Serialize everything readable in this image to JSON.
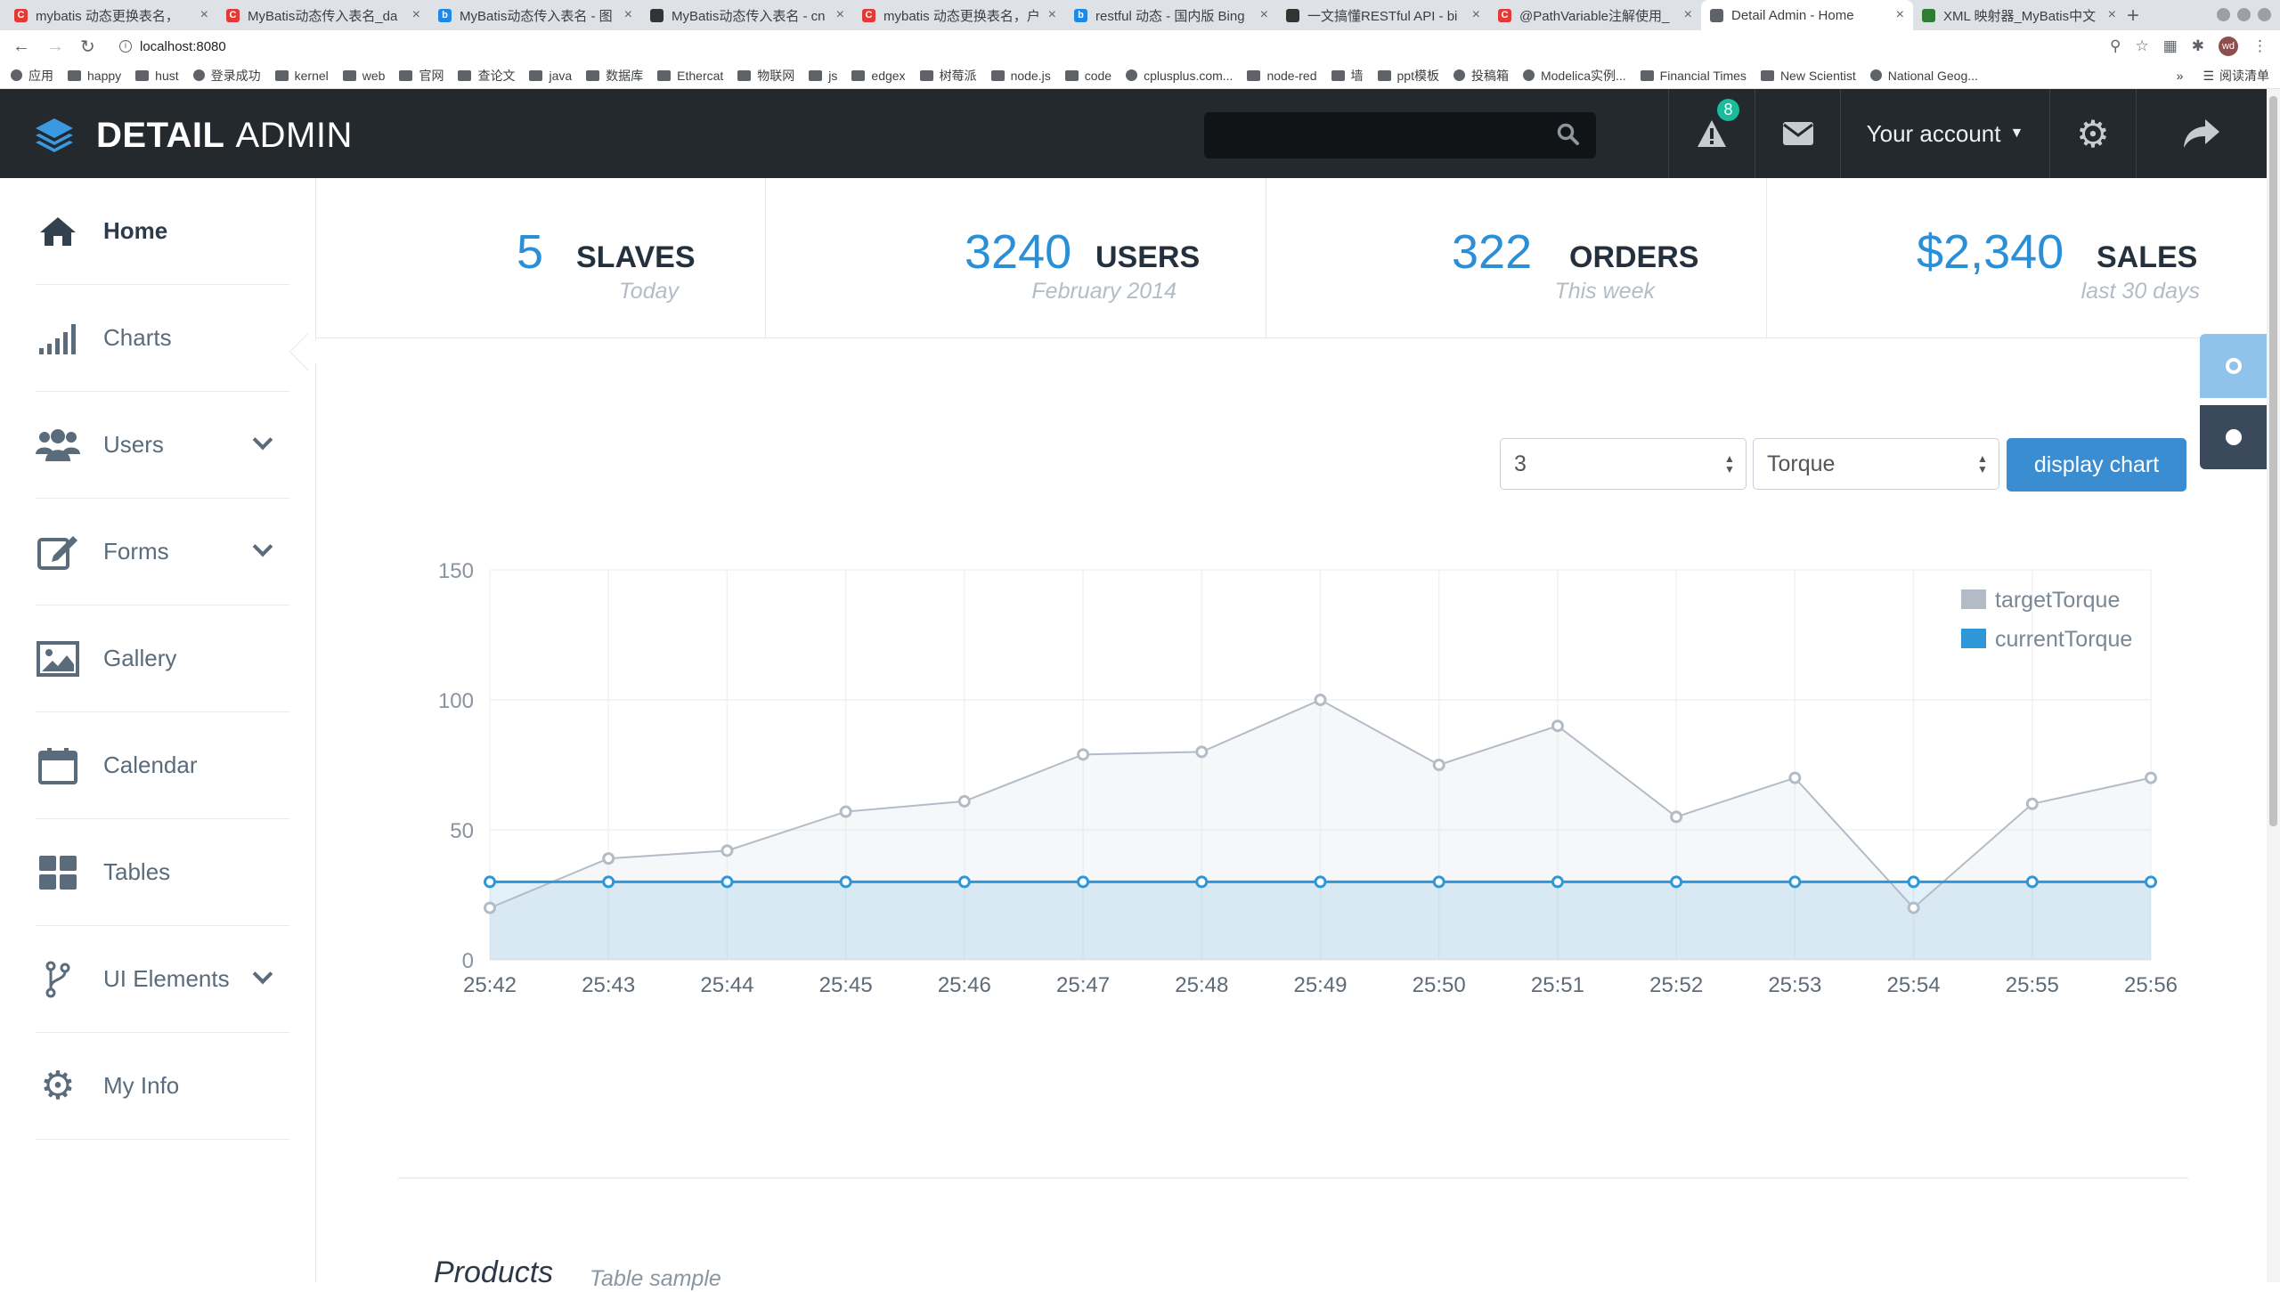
{
  "browser": {
    "tabs": [
      {
        "title": "mybatis 动态更换表名，",
        "favicon": "#e53935",
        "glyph": "C"
      },
      {
        "title": "MyBatis动态传入表名_da",
        "favicon": "#e53935",
        "glyph": "C"
      },
      {
        "title": "MyBatis动态传入表名 - 图",
        "favicon": "#1e88e5",
        "glyph": "b"
      },
      {
        "title": "MyBatis动态传入表名 - cn",
        "favicon": "#333333",
        "glyph": ""
      },
      {
        "title": "mybatis 动态更换表名，户",
        "favicon": "#e53935",
        "glyph": "C"
      },
      {
        "title": "restful 动态 - 国内版 Bing",
        "favicon": "#1e88e5",
        "glyph": "b"
      },
      {
        "title": "一文搞懂RESTful API - bi",
        "favicon": "#333333",
        "glyph": ""
      },
      {
        "title": "@PathVariable注解使用_",
        "favicon": "#e53935",
        "glyph": "C"
      },
      {
        "title": "Detail Admin - Home",
        "favicon": "#5f6368",
        "glyph": ""
      },
      {
        "title": "XML 映射器_MyBatis中文",
        "favicon": "#2e7d32",
        "glyph": ""
      }
    ],
    "url": "localhost:8080",
    "bookmarks": [
      "应用",
      "happy",
      "hust",
      "登录成功",
      "kernel",
      "web",
      "官网",
      "查论文",
      "java",
      "数据库",
      "Ethercat",
      "物联网",
      "js",
      "edgex",
      "树莓派",
      "node.js",
      "code",
      "cplusplus.com...",
      "node-red",
      "墙",
      "ppt模板",
      "投稿箱",
      "Modelica实例...",
      "Financial Times",
      "New Scientist",
      "National Geog..."
    ],
    "bookmarks_more": "»",
    "reading_list": "阅读清单",
    "profile_initials": "wd"
  },
  "app": {
    "logo_word1": "DETAIL",
    "logo_word2": "ADMIN",
    "alerts_count": "8",
    "account_label": "Your account"
  },
  "sidebar": {
    "items": [
      {
        "label": "Home",
        "icon": "home-icon",
        "active": true
      },
      {
        "label": "Charts",
        "icon": "bar-chart-icon"
      },
      {
        "label": "Users",
        "icon": "users-icon",
        "expandable": true
      },
      {
        "label": "Forms",
        "icon": "edit-icon",
        "expandable": true
      },
      {
        "label": "Gallery",
        "icon": "picture-icon"
      },
      {
        "label": "Calendar",
        "icon": "calendar-icon"
      },
      {
        "label": "Tables",
        "icon": "grid-icon"
      },
      {
        "label": "UI Elements",
        "icon": "code-fork-icon",
        "expandable": true
      },
      {
        "label": "My Info",
        "icon": "gear-icon"
      }
    ]
  },
  "stats": [
    {
      "value": "5",
      "label": "SLAVES",
      "sub": "Today"
    },
    {
      "value": "3240",
      "label": "USERS",
      "sub": "February 2014"
    },
    {
      "value": "322",
      "label": "ORDERS",
      "sub": "This week"
    },
    {
      "value": "$2,340",
      "label": "SALES",
      "sub": "last 30 days"
    }
  ],
  "controls": {
    "slave_select": "3",
    "metric_select": "Torque",
    "display_button": "display chart"
  },
  "chart_data": {
    "type": "line",
    "x": [
      "25:42",
      "25:43",
      "25:44",
      "25:45",
      "25:46",
      "25:47",
      "25:48",
      "25:49",
      "25:50",
      "25:51",
      "25:52",
      "25:53",
      "25:54",
      "25:55",
      "25:56"
    ],
    "ylim": [
      0,
      150
    ],
    "yticks": [
      0,
      50,
      100,
      150
    ],
    "legend_position": "top-right",
    "grid": true,
    "series": [
      {
        "name": "targetTorque",
        "color": "#b3bcc6",
        "values": [
          20,
          39,
          42,
          57,
          61,
          79,
          80,
          100,
          75,
          90,
          55,
          70,
          20,
          60,
          70
        ]
      },
      {
        "name": "currentTorque",
        "color": "#2f97d8",
        "values": [
          30,
          30,
          30,
          30,
          30,
          30,
          30,
          30,
          30,
          30,
          30,
          30,
          30,
          30,
          30
        ]
      }
    ]
  },
  "products": {
    "title": "Products",
    "subtitle": "Table sample"
  }
}
